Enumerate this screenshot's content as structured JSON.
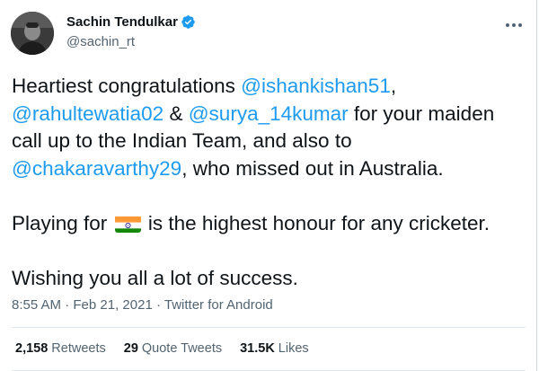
{
  "tweet": {
    "author": {
      "display_name": "Sachin Tendulkar",
      "handle": "@sachin_rt",
      "verified_icon": "verified-badge-icon"
    },
    "body": {
      "line1": {
        "text": "Heartiest congratulations ",
        "mention": "@ishankishan51",
        "tail": ","
      },
      "line2": {
        "mention1": "@rahultewatia02",
        "mid": " & ",
        "mention2": "@surya_14kumar",
        "tail": " for your maiden"
      },
      "line3": {
        "text": "call up to the Indian Team, and also to"
      },
      "line4": {
        "mention": "@chakaravarthy29",
        "tail": ", who missed out in Australia."
      },
      "line5": {
        "text": "Playing for ",
        "flag_icon": "india-flag-icon",
        "tail": " is the highest honour for any cricketer."
      },
      "line6": {
        "text": "Wishing you all a lot of success."
      }
    },
    "meta": {
      "time": "8:55 AM",
      "sep1": " · ",
      "date": "Feb 21, 2021",
      "sep2": " · ",
      "source": "Twitter for Android"
    },
    "stats": {
      "retweets_count": "2,158",
      "retweets_label": "Retweets",
      "quotes_count": "29",
      "quotes_label": "Quote Tweets",
      "likes_count": "31.5K",
      "likes_label": "Likes"
    },
    "colors": {
      "mention": "#1d9bf0",
      "secondary_text": "#536471",
      "verified": "#1d9bf0"
    }
  }
}
